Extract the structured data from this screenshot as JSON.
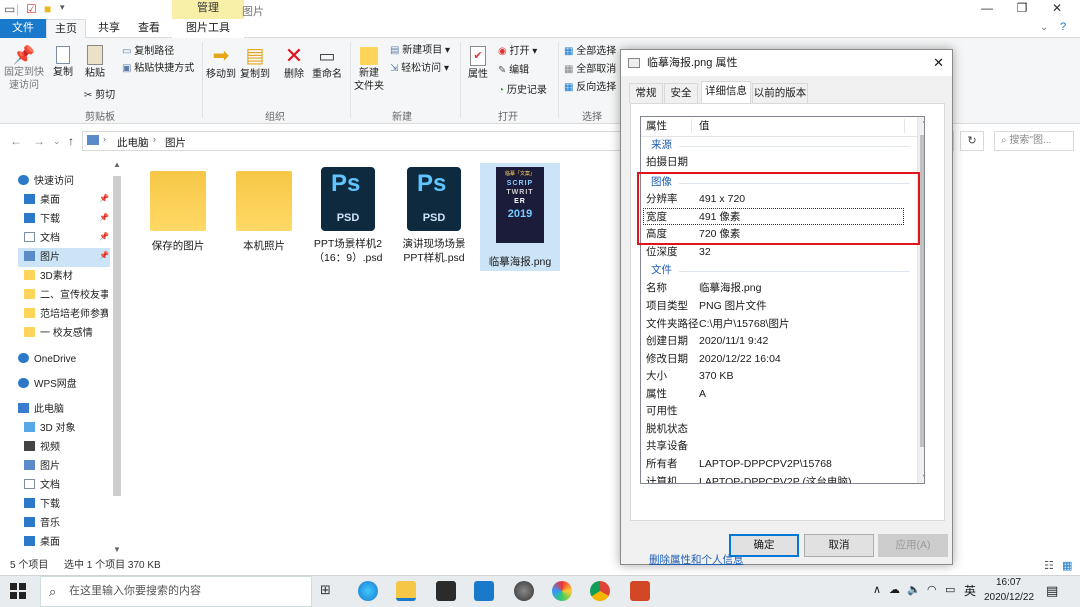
{
  "window": {
    "title": "图片",
    "manage_tab": "管理"
  },
  "ribbon_tabs": [
    "文件",
    "主页",
    "共享",
    "查看",
    "图片工具"
  ],
  "ribbon": {
    "clipboard": {
      "pin": "固定到快\n速访问",
      "copy": "复制",
      "paste": "粘贴",
      "copy_path": "复制路径",
      "paste_shortcut": "粘贴快捷方式",
      "cut": "剪切",
      "label": "剪贴板"
    },
    "organize": {
      "move_to": "移动到",
      "copy_to": "复制到",
      "delete": "删除",
      "rename": "重命名",
      "label": "组织"
    },
    "new": {
      "new_folder": "新建\n文件夹",
      "new_item": "新建项目",
      "easy_access": "轻松访问",
      "label": "新建"
    },
    "open": {
      "properties": "属性",
      "open": "打开",
      "edit": "编辑",
      "history": "历史记录",
      "label": "打开"
    },
    "select": {
      "select_all": "全部选择",
      "select_none": "全部取消",
      "invert": "反向选择",
      "label": "选择"
    }
  },
  "address": {
    "path": [
      "此电脑",
      "图片"
    ],
    "search_placeholder": "搜索\"图..."
  },
  "nav": [
    {
      "label": "快速访问",
      "icon": "star-icon"
    },
    {
      "label": "桌面",
      "icon": "desktop-icon"
    },
    {
      "label": "下载",
      "icon": "download-icon"
    },
    {
      "label": "文档",
      "icon": "document-icon"
    },
    {
      "label": "图片",
      "icon": "pictures-icon"
    },
    {
      "label": "3D素材",
      "icon": "folder-icon"
    },
    {
      "label": "二、宣传校友事",
      "icon": "folder-icon"
    },
    {
      "label": "范培培老师参赛",
      "icon": "folder-icon"
    },
    {
      "label": "一 校友感情",
      "icon": "folder-icon"
    },
    {
      "label": "OneDrive",
      "icon": "cloud-icon"
    },
    {
      "label": "WPS网盘",
      "icon": "cloud-icon"
    },
    {
      "label": "此电脑",
      "icon": "pc-icon"
    },
    {
      "label": "3D 对象",
      "icon": "cube-icon"
    },
    {
      "label": "视频",
      "icon": "video-icon"
    },
    {
      "label": "图片",
      "icon": "pictures-icon"
    },
    {
      "label": "文档",
      "icon": "document-icon"
    },
    {
      "label": "下载",
      "icon": "download-icon"
    },
    {
      "label": "音乐",
      "icon": "music-icon"
    },
    {
      "label": "桌面",
      "icon": "desktop-icon"
    }
  ],
  "files": [
    {
      "name": "保存的图片",
      "type": "folder"
    },
    {
      "name": "本机照片",
      "type": "folder"
    },
    {
      "name": "PPT场景样机2（16：9）.psd",
      "type": "psd",
      "icon_text": "Ps",
      "icon_sub": "PSD"
    },
    {
      "name": "演讲现场场景PPT样机.psd",
      "type": "psd",
      "icon_text": "Ps",
      "icon_sub": "PSD"
    },
    {
      "name": "临摹海报.png",
      "type": "image"
    }
  ],
  "poster_text": [
    "临摹「文案」",
    "SCRIP",
    "TWRIT",
    "ER",
    "2019"
  ],
  "status": {
    "count": "5 个项目",
    "selected": "选中 1 个项目  370 KB"
  },
  "taskbar": {
    "search_placeholder": "在这里输入你要搜索的内容",
    "ime": "英",
    "time": "16:07",
    "date": "2020/12/22"
  },
  "dialog": {
    "title": "临摹海报.png 属性",
    "tabs": [
      "常规",
      "安全",
      "详细信息",
      "以前的版本"
    ],
    "header": {
      "prop": "属性",
      "value": "值"
    },
    "sections": {
      "source": "来源",
      "image": "图像",
      "file": "文件"
    },
    "rows": {
      "shot_date": {
        "k": "拍摄日期",
        "v": ""
      },
      "resolution": {
        "k": "分辨率",
        "v": "491 x 720"
      },
      "width": {
        "k": "宽度",
        "v": "491 像素"
      },
      "height": {
        "k": "高度",
        "v": "720 像素"
      },
      "bit_depth": {
        "k": "位深度",
        "v": "32"
      },
      "name": {
        "k": "名称",
        "v": "临摹海报.png"
      },
      "item_type": {
        "k": "项目类型",
        "v": "PNG 图片文件"
      },
      "folder_path": {
        "k": "文件夹路径",
        "v": "C:\\用户\\15768\\图片"
      },
      "created": {
        "k": "创建日期",
        "v": "2020/11/1 9:42"
      },
      "modified": {
        "k": "修改日期",
        "v": "2020/12/22 16:04"
      },
      "size": {
        "k": "大小",
        "v": "370 KB"
      },
      "attributes": {
        "k": "属性",
        "v": "A"
      },
      "availability": {
        "k": "可用性",
        "v": ""
      },
      "offline_status": {
        "k": "脱机状态",
        "v": ""
      },
      "shared_with": {
        "k": "共享设备",
        "v": ""
      },
      "owner": {
        "k": "所有者",
        "v": "LAPTOP-DPPCPV2P\\15768"
      },
      "computer": {
        "k": "计算机",
        "v": "LAPTOP-DPPCPV2P (这台电脑)"
      }
    },
    "remove_link": "删除属性和个人信息",
    "buttons": {
      "ok": "确定",
      "cancel": "取消",
      "apply": "应用(A)"
    }
  }
}
